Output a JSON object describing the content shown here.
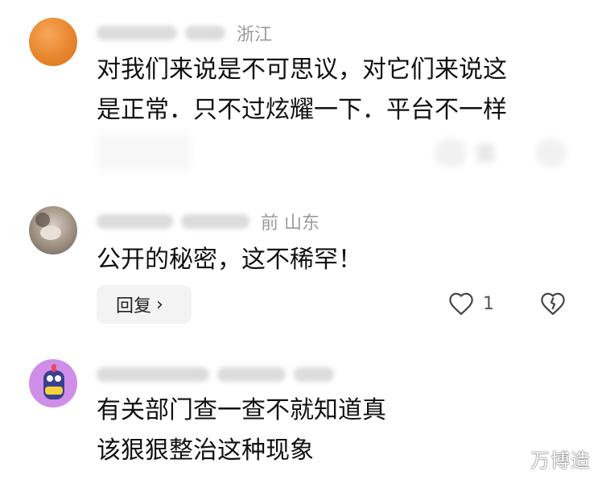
{
  "comments": [
    {
      "location": "浙江",
      "lines": [
        "对我们来说是不可思议，对它们来说这",
        "是正常．只不过炫耀一下．平台不一样"
      ]
    },
    {
      "location": "前  山东",
      "lines": [
        "公开的秘密，这不稀罕！"
      ],
      "reply_label": "回复",
      "like_count": "1"
    },
    {
      "lines": [
        "有关部门查一查不就知道真",
        "该狠狠整治这种现象"
      ]
    }
  ],
  "watermark": "万博造"
}
